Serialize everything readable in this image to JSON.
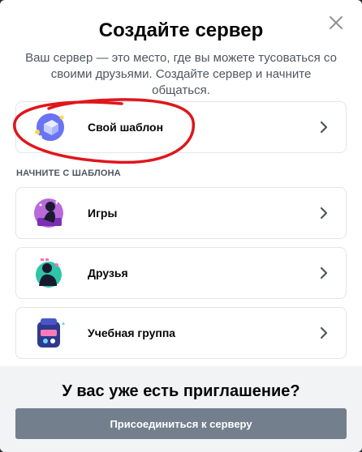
{
  "modal": {
    "title": "Создайте сервер",
    "subtitle": "Ваш сервер — это место, где вы можете тусоваться со своими друзьями. Создайте сервер и начните общаться."
  },
  "custom_template": {
    "label": "Свой шаблон",
    "icon": "custom-server-icon"
  },
  "templates_section": {
    "label": "НАЧНИТЕ С ШАБЛОНА",
    "items": [
      {
        "label": "Игры",
        "icon": "gaming-icon"
      },
      {
        "label": "Друзья",
        "icon": "friends-icon"
      },
      {
        "label": "Учебная группа",
        "icon": "study-group-icon"
      }
    ]
  },
  "footer": {
    "title": "У вас уже есть приглашение?",
    "join_label": "Присоединиться к серверу"
  },
  "colors": {
    "accent": "#5865f2",
    "button_gray": "#747f8d",
    "annotation_red": "#e0161b"
  }
}
